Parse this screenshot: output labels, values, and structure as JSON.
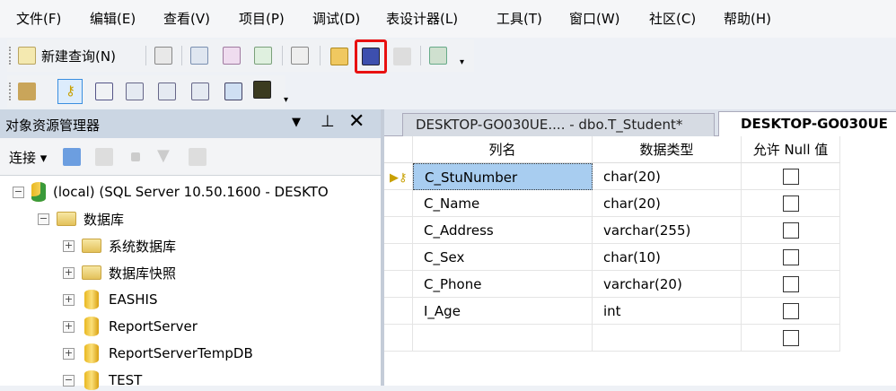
{
  "menu": [
    "文件(F)",
    "编辑(E)",
    "查看(V)",
    "项目(P)",
    "调试(D)",
    "表设计器(L)",
    "工具(T)",
    "窗口(W)",
    "社区(C)",
    "帮助(H)"
  ],
  "toolbar": {
    "new_query": "新建查询(N)"
  },
  "object_explorer": {
    "title": "对象资源管理器",
    "connect": "连接",
    "tree": [
      {
        "label": "(local) (SQL Server 10.50.1600 - DESKTO",
        "level": 0,
        "expanded": true,
        "icon": "server"
      },
      {
        "label": "数据库",
        "level": 1,
        "expanded": true,
        "icon": "folder"
      },
      {
        "label": "系统数据库",
        "level": 2,
        "expanded": false,
        "icon": "folder"
      },
      {
        "label": "数据库快照",
        "level": 2,
        "expanded": false,
        "icon": "folder"
      },
      {
        "label": "EASHIS",
        "level": 2,
        "expanded": false,
        "icon": "database"
      },
      {
        "label": "ReportServer",
        "level": 2,
        "expanded": false,
        "icon": "database"
      },
      {
        "label": "ReportServerTempDB",
        "level": 2,
        "expanded": false,
        "icon": "database"
      },
      {
        "label": "TEST",
        "level": 2,
        "expanded": true,
        "icon": "database"
      }
    ]
  },
  "tabs": [
    {
      "label": "DESKTOP-GO030UE.... - dbo.T_Student*",
      "active": false
    },
    {
      "label": "DESKTOP-GO030UE",
      "active": true
    }
  ],
  "table": {
    "headers": [
      "列名",
      "数据类型",
      "允许 Null 值"
    ],
    "rows": [
      {
        "name": "C_StuNumber",
        "type": "char(20)",
        "null": false,
        "primary_key": true
      },
      {
        "name": "C_Name",
        "type": "char(20)",
        "null": false
      },
      {
        "name": "C_Address",
        "type": "varchar(255)",
        "null": false
      },
      {
        "name": "C_Sex",
        "type": "char(10)",
        "null": false
      },
      {
        "name": "C_Phone",
        "type": "varchar(20)",
        "null": false
      },
      {
        "name": "I_Age",
        "type": "int",
        "null": false
      },
      {
        "name": "",
        "type": "",
        "null": false
      }
    ]
  },
  "colors": {
    "highlight": "#e81010",
    "selected_cell": "#a8cdf0"
  }
}
